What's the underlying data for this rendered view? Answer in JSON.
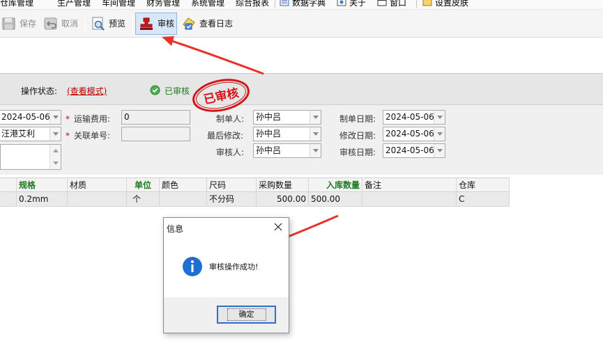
{
  "menu": {
    "items": [
      "仓库管理",
      "生产管理",
      "车间管理",
      "财务管理",
      "系统管理",
      "综合报表",
      "数据字典",
      "关于",
      "窗口",
      "设置皮肤"
    ]
  },
  "toolbar": {
    "save": "保存",
    "cancel": "取消",
    "preview": "预览",
    "audit": "审核",
    "view_log": "查看日志"
  },
  "status": {
    "label": "操作状态:",
    "link": "(查看模式)",
    "state": "已审核",
    "stamp_text": "已审核"
  },
  "form": {
    "date": "2024-05-06",
    "supplier": "汪港艾利",
    "freight_label": "运输费用:",
    "freight_value": "0",
    "related_label": "关联单号:",
    "related_value": "",
    "creator_label": "制单人:",
    "creator": "孙中吕",
    "modifier_label": "最后修改:",
    "modifier": "孙中吕",
    "auditor_label": "审核人:",
    "auditor": "孙中吕",
    "create_date_label": "制单日期:",
    "create_date": "2024-05-06",
    "modify_date_label": "修改日期:",
    "modify_date": "2024-05-06",
    "audit_date_label": "审核日期:",
    "audit_date": "2024-05-06",
    "required_mark": "*"
  },
  "grid": {
    "headers": [
      "规格",
      "材质",
      "单位",
      "颜色",
      "尺码",
      "采购数量",
      "入库数量",
      "备注",
      "仓库"
    ],
    "rows": [
      [
        "0.2mm",
        "",
        "个",
        "",
        "不分码",
        "500.00",
        "500.00",
        "",
        "C"
      ]
    ]
  },
  "dialog": {
    "title": "信息",
    "message": "审核操作成功!",
    "ok": "确定"
  },
  "colors": {
    "accent": "#2a6fc9",
    "stamp_red": "#d2161b",
    "annotation_red": "#e8332b",
    "audited_green": "#1e7a1e"
  }
}
